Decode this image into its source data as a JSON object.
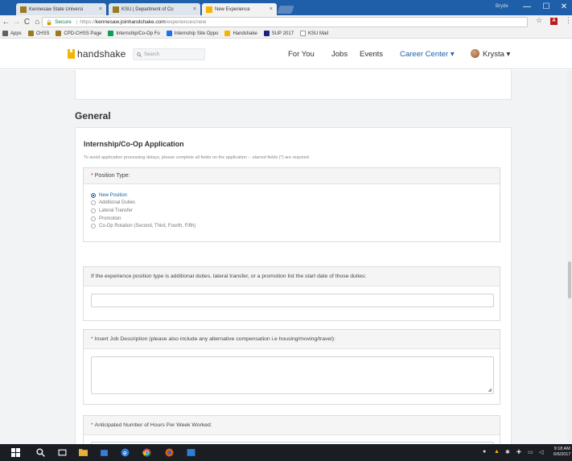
{
  "browser": {
    "tabs": [
      {
        "title": "Kennesaw State Universi",
        "favicon_color": "#9a7a22",
        "active": false
      },
      {
        "title": "KSU | Department of Co",
        "favicon_color": "#9a7a22",
        "active": false
      },
      {
        "title": "New Experience",
        "favicon_color": "#f5b400",
        "active": true
      }
    ],
    "tab_close_glyph": "×",
    "window_user": "Bryde",
    "window_buttons": [
      "—",
      "☐",
      "✕"
    ],
    "nav_buttons": [
      "←",
      "→",
      "C",
      "⌂"
    ],
    "secure_label": "Secure",
    "url_scheme": "https://",
    "url_domain": "kennesaw.joinhandshake.com",
    "url_path": "/experiences/new",
    "bookmarks": [
      {
        "label": "Apps",
        "color": "#5f6368"
      },
      {
        "label": "CHSS",
        "color": "#9a7a22"
      },
      {
        "label": "CPD-CHSS Page",
        "color": "#9a7a22"
      },
      {
        "label": "Internship/Co-Op Fo",
        "color": "#0f9d58"
      },
      {
        "label": "Internship Site Oppo",
        "color": "#1a73e8"
      },
      {
        "label": "Handshake",
        "color": "#f5b400"
      },
      {
        "label": "SUP 2017",
        "color": "#1a237e"
      },
      {
        "label": "KSU Mail",
        "color": "#ffffff"
      }
    ]
  },
  "header": {
    "logo_text": "handshake",
    "search_placeholder": "Search",
    "nav": [
      "For You",
      "Jobs",
      "Events",
      "Career Center ▾"
    ],
    "user_name": "Krysta ▾"
  },
  "section_title": "General",
  "form": {
    "title": "Internship/Co-Op Application",
    "note": "To avoid application processing delays, please complete all fields on the application -- starred fields (*) are required.",
    "questions": [
      {
        "required": true,
        "label": "Position Type:",
        "type": "radio",
        "options": [
          "New Position",
          "Additional Duties",
          "Lateral Transfer",
          "Promotion",
          "Co-Op Rotation (Second, Third, Fourth, Fifth)"
        ],
        "selected": "New Position"
      },
      {
        "required": false,
        "label": "If the experience position type is additional duties, lateral transfer, or a promotion list the start date of those duties:",
        "type": "text",
        "value": ""
      },
      {
        "required": true,
        "label": "Insert Job Description (please also include any alternative compensation i.e housing/moving/travel):",
        "type": "textarea",
        "value": ""
      },
      {
        "required": true,
        "label": "Anticipated Number of Hours Per Week Worked:",
        "type": "text",
        "value": ""
      }
    ],
    "required_marker": "*"
  },
  "taskbar": {
    "time": "9:18 AM",
    "date": "6/6/2017"
  },
  "colors": {
    "chrome_blue": "#1f5faa",
    "handshake_yellow": "#f5b400",
    "link_blue": "#1e5fa8",
    "page_bg": "#f2f3f5"
  }
}
